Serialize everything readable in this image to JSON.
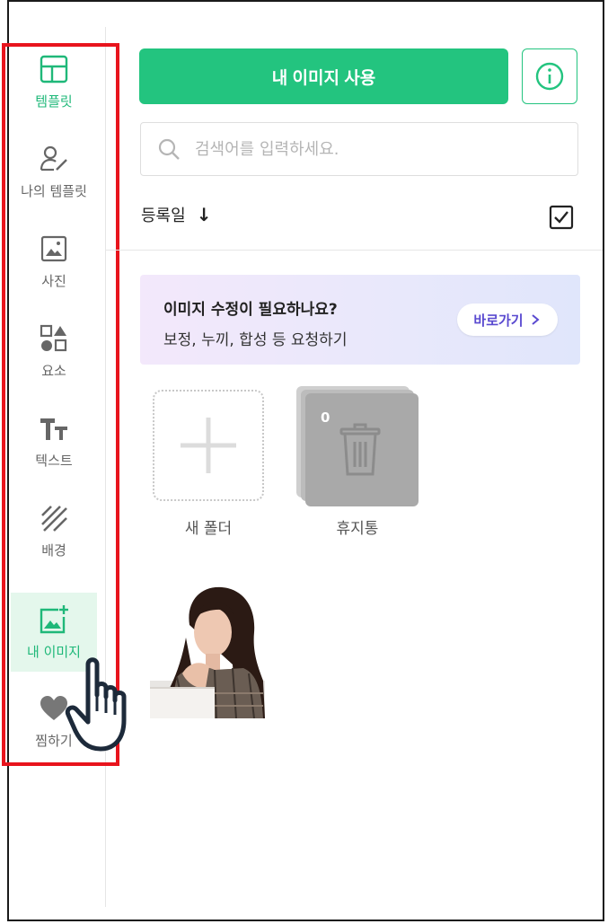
{
  "sidebar": {
    "items": [
      {
        "label": "템플릿",
        "icon": "template-icon"
      },
      {
        "label": "나의 템플릿",
        "icon": "my-template-icon"
      },
      {
        "label": "사진",
        "icon": "photo-icon"
      },
      {
        "label": "요소",
        "icon": "elements-icon"
      },
      {
        "label": "텍스트",
        "icon": "text-icon"
      },
      {
        "label": "배경",
        "icon": "background-icon"
      },
      {
        "label": "내 이미지",
        "icon": "my-image-icon"
      },
      {
        "label": "찜하기",
        "icon": "heart-icon"
      }
    ]
  },
  "toolbar": {
    "use_label": "내 이미지 사용"
  },
  "search": {
    "placeholder": "검색어를 입력하세요."
  },
  "sort": {
    "label": "등록일"
  },
  "banner": {
    "title": "이미지 수정이 필요하나요?",
    "subtitle": "보정, 누끼, 합성 등 요청하기",
    "button": "바로가기"
  },
  "folders": {
    "new_folder": "새 폴더",
    "trash": "휴지통",
    "trash_count": "0"
  },
  "colors": {
    "accent": "#23c47f",
    "highlight_box": "#e8141d",
    "banner_button_text": "#5a4ad0"
  }
}
